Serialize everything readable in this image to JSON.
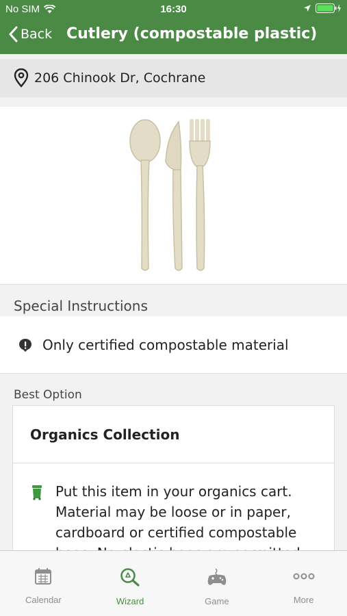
{
  "status_bar": {
    "carrier": "No SIM",
    "time": "16:30"
  },
  "nav": {
    "back_label": "Back",
    "title": "Cutlery (compostable plastic)"
  },
  "address": {
    "text": "206 Chinook Dr, Cochrane"
  },
  "special_instructions": {
    "heading": "Special Instructions",
    "text": "Only certified compostable material"
  },
  "best_option": {
    "heading": "Best Option",
    "title": "Organics Collection",
    "lines": [
      "Put this item in your organics cart.",
      "Material may be loose or in paper,",
      "cardboard or certified compostable",
      "bags. No plastic bags are permitted."
    ]
  },
  "tabs": [
    {
      "label": "Calendar",
      "icon": "calendar-icon"
    },
    {
      "label": "Wizard",
      "icon": "wizard-icon",
      "active": true
    },
    {
      "label": "Game",
      "icon": "gamepad-icon"
    },
    {
      "label": "More",
      "icon": "more-icon"
    }
  ],
  "colors": {
    "brand_green": "#4a8a45",
    "bin_green": "#3f9a3f",
    "inactive_tab": "#8e8e8e"
  }
}
